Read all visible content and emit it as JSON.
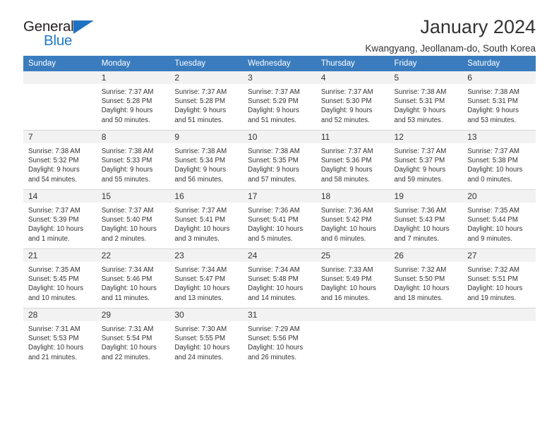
{
  "brand": {
    "name_top": "General",
    "name_bottom": "Blue",
    "triangle_color": "#1f72c2",
    "blue_color": "#1f78c8"
  },
  "header": {
    "title": "January 2024",
    "subtitle": "Kwangyang, Jeollanam-do, South Korea",
    "header_bg": "#3a7cbe",
    "daynum_bg": "#f2f2f2"
  },
  "weekday_headers": [
    "Sunday",
    "Monday",
    "Tuesday",
    "Wednesday",
    "Thursday",
    "Friday",
    "Saturday"
  ],
  "weeks": [
    [
      {
        "day": "",
        "lines": []
      },
      {
        "day": "1",
        "lines": [
          "Sunrise: 7:37 AM",
          "Sunset: 5:28 PM",
          "Daylight: 9 hours",
          "and 50 minutes."
        ]
      },
      {
        "day": "2",
        "lines": [
          "Sunrise: 7:37 AM",
          "Sunset: 5:28 PM",
          "Daylight: 9 hours",
          "and 51 minutes."
        ]
      },
      {
        "day": "3",
        "lines": [
          "Sunrise: 7:37 AM",
          "Sunset: 5:29 PM",
          "Daylight: 9 hours",
          "and 51 minutes."
        ]
      },
      {
        "day": "4",
        "lines": [
          "Sunrise: 7:37 AM",
          "Sunset: 5:30 PM",
          "Daylight: 9 hours",
          "and 52 minutes."
        ]
      },
      {
        "day": "5",
        "lines": [
          "Sunrise: 7:38 AM",
          "Sunset: 5:31 PM",
          "Daylight: 9 hours",
          "and 53 minutes."
        ]
      },
      {
        "day": "6",
        "lines": [
          "Sunrise: 7:38 AM",
          "Sunset: 5:31 PM",
          "Daylight: 9 hours",
          "and 53 minutes."
        ]
      }
    ],
    [
      {
        "day": "7",
        "lines": [
          "Sunrise: 7:38 AM",
          "Sunset: 5:32 PM",
          "Daylight: 9 hours",
          "and 54 minutes."
        ]
      },
      {
        "day": "8",
        "lines": [
          "Sunrise: 7:38 AM",
          "Sunset: 5:33 PM",
          "Daylight: 9 hours",
          "and 55 minutes."
        ]
      },
      {
        "day": "9",
        "lines": [
          "Sunrise: 7:38 AM",
          "Sunset: 5:34 PM",
          "Daylight: 9 hours",
          "and 56 minutes."
        ]
      },
      {
        "day": "10",
        "lines": [
          "Sunrise: 7:38 AM",
          "Sunset: 5:35 PM",
          "Daylight: 9 hours",
          "and 57 minutes."
        ]
      },
      {
        "day": "11",
        "lines": [
          "Sunrise: 7:37 AM",
          "Sunset: 5:36 PM",
          "Daylight: 9 hours",
          "and 58 minutes."
        ]
      },
      {
        "day": "12",
        "lines": [
          "Sunrise: 7:37 AM",
          "Sunset: 5:37 PM",
          "Daylight: 9 hours",
          "and 59 minutes."
        ]
      },
      {
        "day": "13",
        "lines": [
          "Sunrise: 7:37 AM",
          "Sunset: 5:38 PM",
          "Daylight: 10 hours",
          "and 0 minutes."
        ]
      }
    ],
    [
      {
        "day": "14",
        "lines": [
          "Sunrise: 7:37 AM",
          "Sunset: 5:39 PM",
          "Daylight: 10 hours",
          "and 1 minute."
        ]
      },
      {
        "day": "15",
        "lines": [
          "Sunrise: 7:37 AM",
          "Sunset: 5:40 PM",
          "Daylight: 10 hours",
          "and 2 minutes."
        ]
      },
      {
        "day": "16",
        "lines": [
          "Sunrise: 7:37 AM",
          "Sunset: 5:41 PM",
          "Daylight: 10 hours",
          "and 3 minutes."
        ]
      },
      {
        "day": "17",
        "lines": [
          "Sunrise: 7:36 AM",
          "Sunset: 5:41 PM",
          "Daylight: 10 hours",
          "and 5 minutes."
        ]
      },
      {
        "day": "18",
        "lines": [
          "Sunrise: 7:36 AM",
          "Sunset: 5:42 PM",
          "Daylight: 10 hours",
          "and 6 minutes."
        ]
      },
      {
        "day": "19",
        "lines": [
          "Sunrise: 7:36 AM",
          "Sunset: 5:43 PM",
          "Daylight: 10 hours",
          "and 7 minutes."
        ]
      },
      {
        "day": "20",
        "lines": [
          "Sunrise: 7:35 AM",
          "Sunset: 5:44 PM",
          "Daylight: 10 hours",
          "and 9 minutes."
        ]
      }
    ],
    [
      {
        "day": "21",
        "lines": [
          "Sunrise: 7:35 AM",
          "Sunset: 5:45 PM",
          "Daylight: 10 hours",
          "and 10 minutes."
        ]
      },
      {
        "day": "22",
        "lines": [
          "Sunrise: 7:34 AM",
          "Sunset: 5:46 PM",
          "Daylight: 10 hours",
          "and 11 minutes."
        ]
      },
      {
        "day": "23",
        "lines": [
          "Sunrise: 7:34 AM",
          "Sunset: 5:47 PM",
          "Daylight: 10 hours",
          "and 13 minutes."
        ]
      },
      {
        "day": "24",
        "lines": [
          "Sunrise: 7:34 AM",
          "Sunset: 5:48 PM",
          "Daylight: 10 hours",
          "and 14 minutes."
        ]
      },
      {
        "day": "25",
        "lines": [
          "Sunrise: 7:33 AM",
          "Sunset: 5:49 PM",
          "Daylight: 10 hours",
          "and 16 minutes."
        ]
      },
      {
        "day": "26",
        "lines": [
          "Sunrise: 7:32 AM",
          "Sunset: 5:50 PM",
          "Daylight: 10 hours",
          "and 18 minutes."
        ]
      },
      {
        "day": "27",
        "lines": [
          "Sunrise: 7:32 AM",
          "Sunset: 5:51 PM",
          "Daylight: 10 hours",
          "and 19 minutes."
        ]
      }
    ],
    [
      {
        "day": "28",
        "lines": [
          "Sunrise: 7:31 AM",
          "Sunset: 5:53 PM",
          "Daylight: 10 hours",
          "and 21 minutes."
        ]
      },
      {
        "day": "29",
        "lines": [
          "Sunrise: 7:31 AM",
          "Sunset: 5:54 PM",
          "Daylight: 10 hours",
          "and 22 minutes."
        ]
      },
      {
        "day": "30",
        "lines": [
          "Sunrise: 7:30 AM",
          "Sunset: 5:55 PM",
          "Daylight: 10 hours",
          "and 24 minutes."
        ]
      },
      {
        "day": "31",
        "lines": [
          "Sunrise: 7:29 AM",
          "Sunset: 5:56 PM",
          "Daylight: 10 hours",
          "and 26 minutes."
        ]
      },
      {
        "day": "",
        "lines": []
      },
      {
        "day": "",
        "lines": []
      },
      {
        "day": "",
        "lines": []
      }
    ]
  ]
}
